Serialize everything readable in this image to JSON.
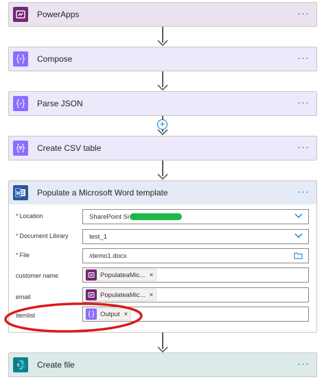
{
  "steps": [
    {
      "title": "PowerApps",
      "icon": "powerapps-icon",
      "header_bg": "#ebe3ef",
      "tile_bg": "#742774"
    },
    {
      "title": "Compose",
      "icon": "expression-icon",
      "header_bg": "#ece9fb",
      "tile_bg": "#8c6cff"
    },
    {
      "title": "Parse JSON",
      "icon": "expression-icon",
      "header_bg": "#ece9fb",
      "tile_bg": "#8c6cff"
    },
    {
      "title": "Create CSV table",
      "icon": "table-icon",
      "header_bg": "#ece9fb",
      "tile_bg": "#8c6cff"
    },
    {
      "title": "Populate a Microsoft Word template",
      "icon": "word-icon",
      "header_bg": "#e4ebf7",
      "tile_bg": "#2b579a"
    },
    {
      "title": "Create file",
      "icon": "sharepoint-icon",
      "header_bg": "#dcebea",
      "tile_bg": "#0b828a"
    }
  ],
  "word_fields": {
    "location": {
      "label": "Location",
      "value": "SharePoint Si",
      "required": true
    },
    "library": {
      "label": "Document Library",
      "value": "test_1",
      "required": true
    },
    "file": {
      "label": "File",
      "value": "/demo1.docx",
      "required": true
    },
    "customer_name": {
      "label": "customer name",
      "token": "PopulateaMic..."
    },
    "email": {
      "label": "email",
      "token": "PopulateaMic..."
    },
    "itemlist": {
      "label": "itemlist",
      "token": "Output"
    }
  },
  "more_label": "···",
  "token_remove": "×",
  "add_step": "+",
  "colors": {
    "accent": "#0078d4",
    "highlight_green": "#1db84a",
    "annotation_red": "#d81b1b"
  }
}
